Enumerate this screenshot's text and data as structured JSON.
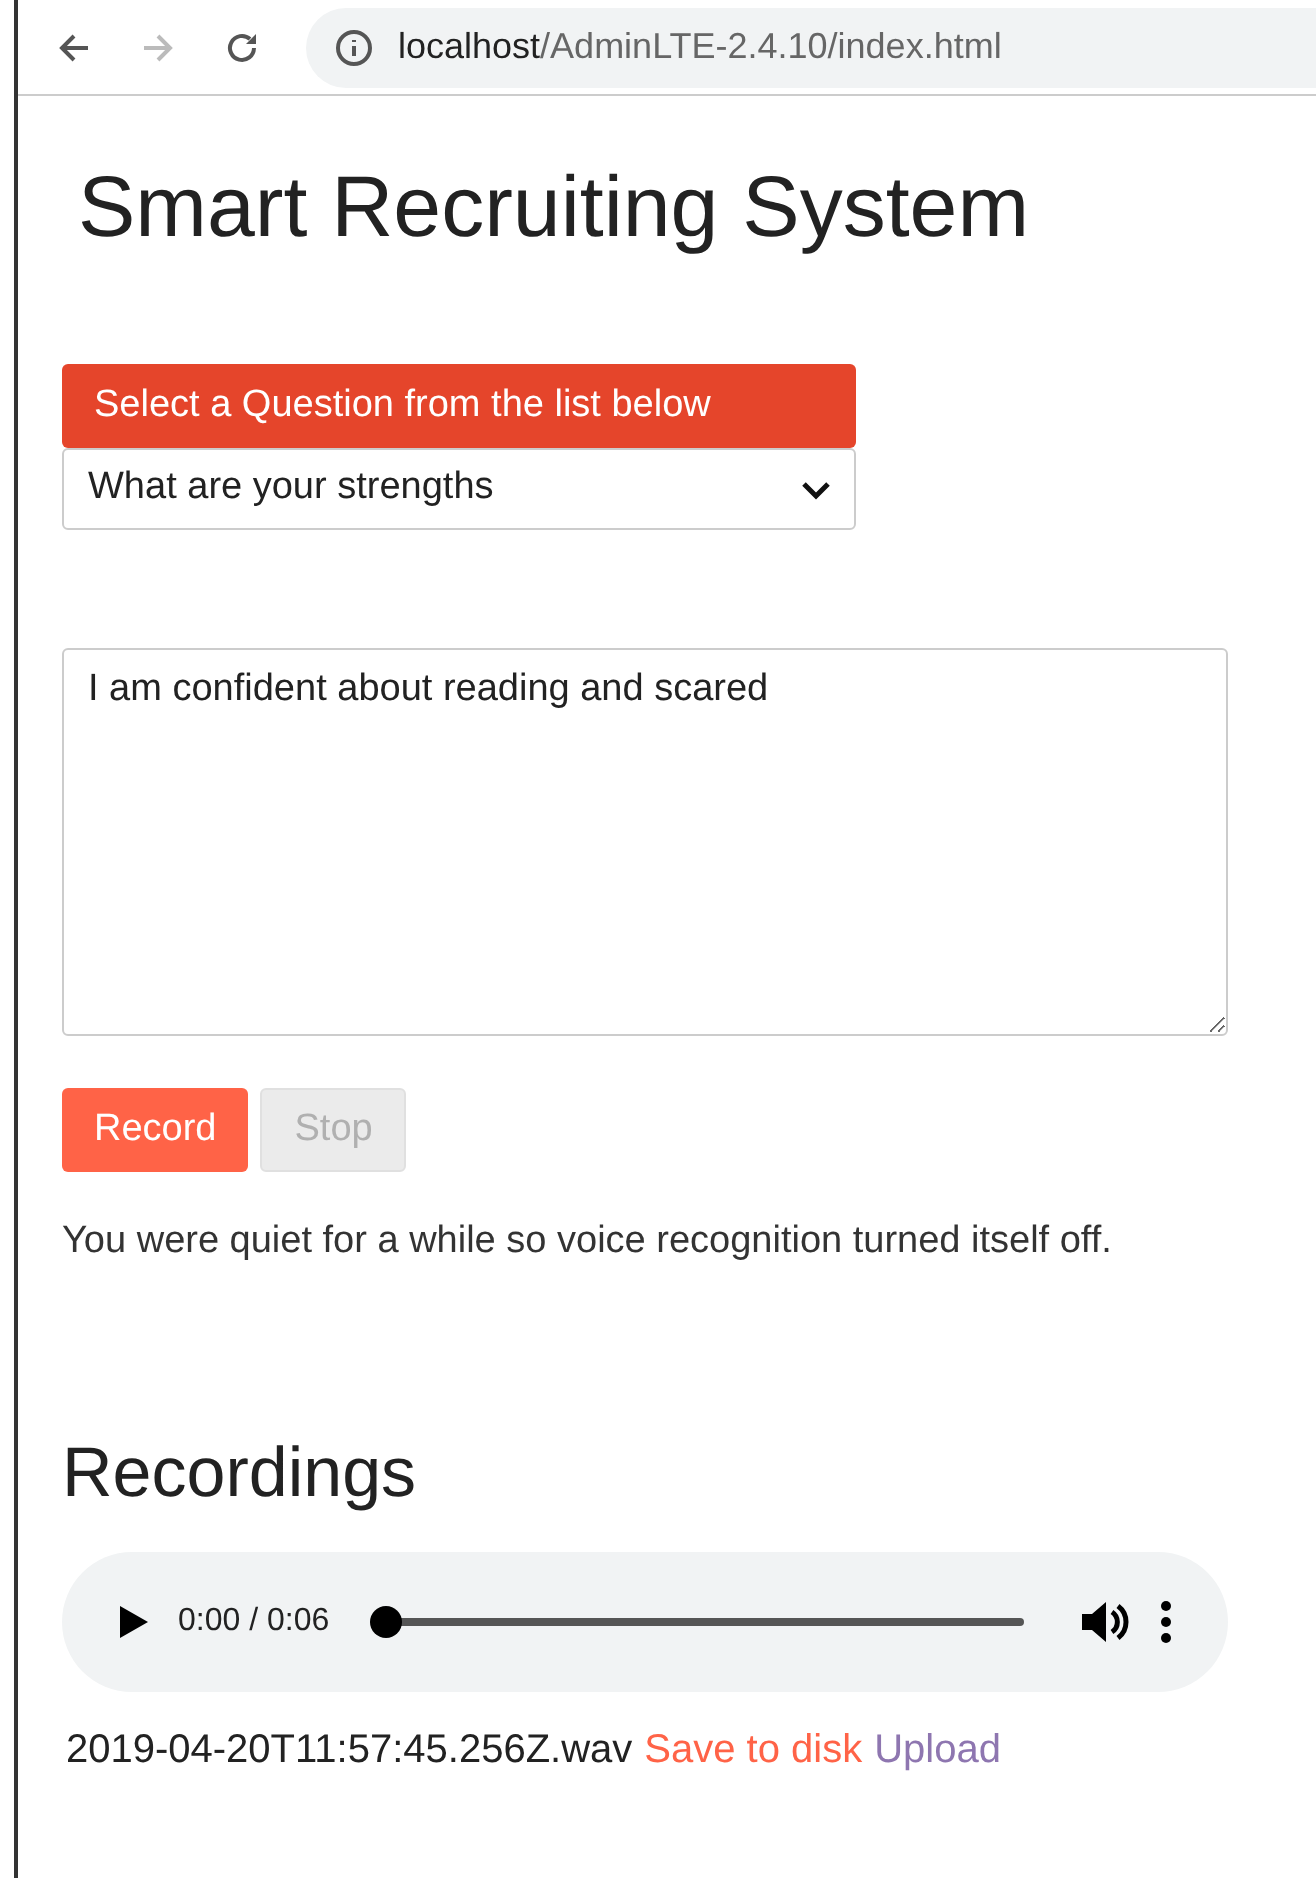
{
  "browser": {
    "url_host": "localhost",
    "url_path": "/AdminLTE-2.4.10/index.html",
    "forward_disabled": true
  },
  "title": "Smart Recruiting System",
  "question_button": "Select a Question from the list below",
  "question_select": {
    "value": "What are your strengths"
  },
  "answer": {
    "value": "I am confident about reading and scared"
  },
  "buttons": [
    {
      "label": "Record",
      "disabled": false
    },
    {
      "label": "Stop",
      "disabled": true
    }
  ],
  "status_message": "You were quiet for a while so voice recognition turned itself off.",
  "recordings_heading": "Recordings",
  "recordings": [
    {
      "time": "0:00 / 0:06",
      "level": 0,
      "filename": "2019-04-20T11:57:45.256Z.wav",
      "save_link": "Save to disk",
      "upload_link": "Upload"
    }
  ]
}
